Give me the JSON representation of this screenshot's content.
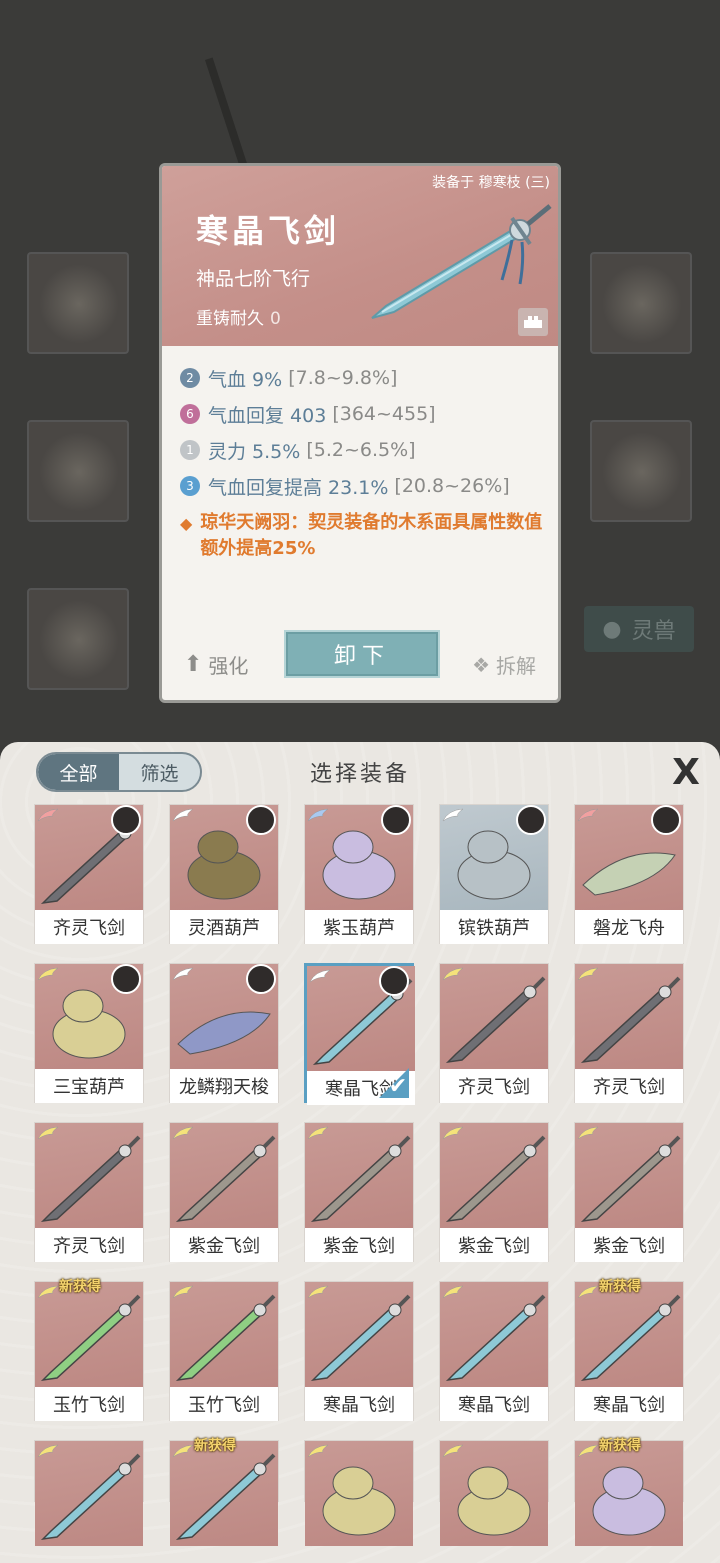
{
  "detail": {
    "equipped_by": "装备于 穆寒枝 (三)",
    "title": "寒晶飞剑",
    "grade": "神品七阶飞行",
    "recast_label": "重铸耐久",
    "recast_value": "0",
    "stats": [
      {
        "rank": "2",
        "rank_color": "#6f8ba3",
        "text": "气血 9%",
        "range": "[7.8~9.8%]"
      },
      {
        "rank": "6",
        "rank_color": "#c06f9a",
        "text": "气血回复 403",
        "range": "[364~455]"
      },
      {
        "rank": "1",
        "rank_color": "#c0c4c7",
        "text": "灵力 5.5%",
        "range": "[5.2~6.5%]"
      },
      {
        "rank": "3",
        "rank_color": "#5a9fd0",
        "text": "气血回复提高 23.1%",
        "range": "[20.8~26%]"
      }
    ],
    "special": "琼华天阙羽：契灵装备的木系面具属性数值额外提高25%",
    "actions": {
      "strengthen": "强化",
      "unequip": "卸下",
      "dismantle": "拆解"
    }
  },
  "background": {
    "lingshou_label": "灵兽"
  },
  "sheet": {
    "tab_all": "全部",
    "tab_filter": "筛选",
    "title": "选择装备",
    "close_glyph": "X"
  },
  "items": [
    {
      "name": "齐灵飞剑",
      "wing": "#f1a0a0",
      "avatar": true,
      "new": false,
      "lock": false,
      "selected": false,
      "kind": "sword",
      "blade": "#6f6f74"
    },
    {
      "name": "灵酒葫芦",
      "wing": "#ffffff",
      "avatar": true,
      "new": false,
      "lock": false,
      "selected": false,
      "kind": "gourd",
      "blade": "#8a7b4f"
    },
    {
      "name": "紫玉葫芦",
      "wing": "#a9c9f0",
      "avatar": true,
      "new": false,
      "lock": true,
      "selected": false,
      "kind": "gourd",
      "blade": "#c9bde0"
    },
    {
      "name": "镔铁葫芦",
      "wing": "#ffffff",
      "avatar": true,
      "new": false,
      "lock": false,
      "selected": false,
      "kind": "gourd",
      "blade": "#b7c1c6",
      "blue": true
    },
    {
      "name": "磐龙飞舟",
      "wing": "#f1a0a0",
      "avatar": true,
      "new": false,
      "lock": true,
      "selected": false,
      "kind": "boat",
      "blade": "#c5d1b4"
    },
    {
      "name": "三宝葫芦",
      "wing": "#f5e27a",
      "avatar": true,
      "new": false,
      "lock": true,
      "selected": false,
      "kind": "gourd",
      "blade": "#d9cf95"
    },
    {
      "name": "龙鳞翔天梭",
      "wing": "#ffffff",
      "avatar": true,
      "new": false,
      "lock": false,
      "selected": false,
      "kind": "boat",
      "blade": "#8f98c7"
    },
    {
      "name": "寒晶飞剑",
      "wing": "#ffffff",
      "avatar": true,
      "new": false,
      "lock": false,
      "selected": true,
      "kind": "sword",
      "blade": "#8ec9d6"
    },
    {
      "name": "齐灵飞剑",
      "wing": "#f5e27a",
      "avatar": false,
      "new": false,
      "lock": false,
      "selected": false,
      "kind": "sword",
      "blade": "#6f6f74"
    },
    {
      "name": "齐灵飞剑",
      "wing": "#f5e27a",
      "avatar": false,
      "new": false,
      "lock": false,
      "selected": false,
      "kind": "sword",
      "blade": "#6f6f74"
    },
    {
      "name": "齐灵飞剑",
      "wing": "#f5e27a",
      "avatar": false,
      "new": false,
      "lock": false,
      "selected": false,
      "kind": "sword",
      "blade": "#6f6f74"
    },
    {
      "name": "紫金飞剑",
      "wing": "#f5e27a",
      "avatar": false,
      "new": false,
      "lock": false,
      "selected": false,
      "kind": "sword",
      "blade": "#9d978d"
    },
    {
      "name": "紫金飞剑",
      "wing": "#f5e27a",
      "avatar": false,
      "new": false,
      "lock": false,
      "selected": false,
      "kind": "sword",
      "blade": "#9d978d"
    },
    {
      "name": "紫金飞剑",
      "wing": "#f5e27a",
      "avatar": false,
      "new": false,
      "lock": false,
      "selected": false,
      "kind": "sword",
      "blade": "#9d978d"
    },
    {
      "name": "紫金飞剑",
      "wing": "#f5e27a",
      "avatar": false,
      "new": false,
      "lock": false,
      "selected": false,
      "kind": "sword",
      "blade": "#9d978d"
    },
    {
      "name": "玉竹飞剑",
      "wing": "#f5e27a",
      "avatar": false,
      "new": true,
      "lock": false,
      "selected": false,
      "kind": "sword",
      "blade": "#8fcf83"
    },
    {
      "name": "玉竹飞剑",
      "wing": "#f5e27a",
      "avatar": false,
      "new": false,
      "lock": false,
      "selected": false,
      "kind": "sword",
      "blade": "#8fcf83"
    },
    {
      "name": "寒晶飞剑",
      "wing": "#f5e27a",
      "avatar": false,
      "new": false,
      "lock": false,
      "selected": false,
      "kind": "sword",
      "blade": "#8ec9d6"
    },
    {
      "name": "寒晶飞剑",
      "wing": "#f5e27a",
      "avatar": false,
      "new": false,
      "lock": false,
      "selected": false,
      "kind": "sword",
      "blade": "#8ec9d6"
    },
    {
      "name": "寒晶飞剑",
      "wing": "#f5e27a",
      "avatar": false,
      "new": true,
      "lock": false,
      "selected": false,
      "kind": "sword",
      "blade": "#8ec9d6"
    },
    {
      "name": "",
      "wing": "#f5e27a",
      "avatar": false,
      "new": false,
      "lock": false,
      "selected": false,
      "kind": "sword",
      "blade": "#8ec9d6"
    },
    {
      "name": "",
      "wing": "#f5e27a",
      "avatar": false,
      "new": true,
      "lock": false,
      "selected": false,
      "kind": "sword",
      "blade": "#8ec9d6"
    },
    {
      "name": "",
      "wing": "#f5e27a",
      "avatar": false,
      "new": false,
      "lock": false,
      "selected": false,
      "kind": "gourd",
      "blade": "#d9cf95"
    },
    {
      "name": "",
      "wing": "#f5e27a",
      "avatar": false,
      "new": false,
      "lock": false,
      "selected": false,
      "kind": "gourd",
      "blade": "#d9cf95"
    },
    {
      "name": "",
      "wing": "#f5e27a",
      "avatar": false,
      "new": true,
      "lock": false,
      "selected": false,
      "kind": "gourd",
      "blade": "#c9bde0"
    }
  ],
  "new_tag_text": "新获得",
  "icons": {
    "strengthen": "up-arrow-icon",
    "dismantle": "dismantle-icon",
    "lock": "lock-icon",
    "close": "close-icon",
    "special": "diamond-icon",
    "selected": "checkmark-icon"
  },
  "colors": {
    "accent_teal": "#7fb0b5",
    "special_orange": "#e07b2f",
    "stat_blue": "#5d7e97",
    "card_pink": "#c48f89",
    "selected_border": "#5a9fc2"
  }
}
